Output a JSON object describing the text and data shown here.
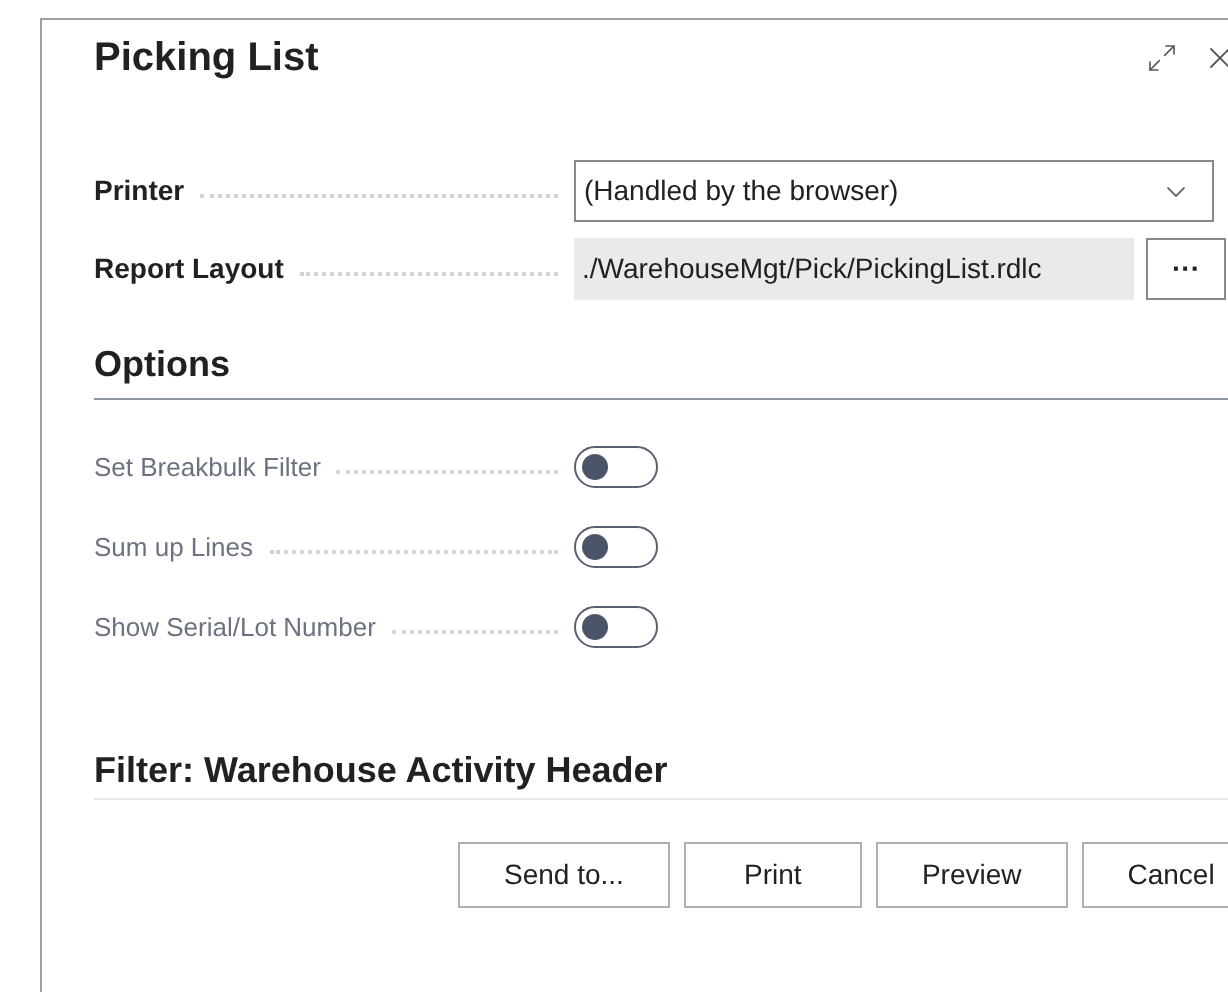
{
  "dialog": {
    "title": "Picking List"
  },
  "fields": [
    {
      "label": "Printer",
      "kind": "dropdown",
      "value": "(Handled by the browser)"
    },
    {
      "label": "Report Layout",
      "kind": "lookup",
      "value": "./WarehouseMgt/Pick/PickingList.rdlc",
      "button": "···"
    }
  ],
  "options": {
    "heading": "Options",
    "items": [
      {
        "label": "Set Breakbulk Filter",
        "on": false
      },
      {
        "label": "Sum up Lines",
        "on": false
      },
      {
        "label": "Show Serial/Lot Number",
        "on": false
      }
    ]
  },
  "filter": {
    "heading": "Filter: Warehouse Activity Header"
  },
  "buttons": [
    "Send to...",
    "Print",
    "Preview",
    "Cancel"
  ]
}
